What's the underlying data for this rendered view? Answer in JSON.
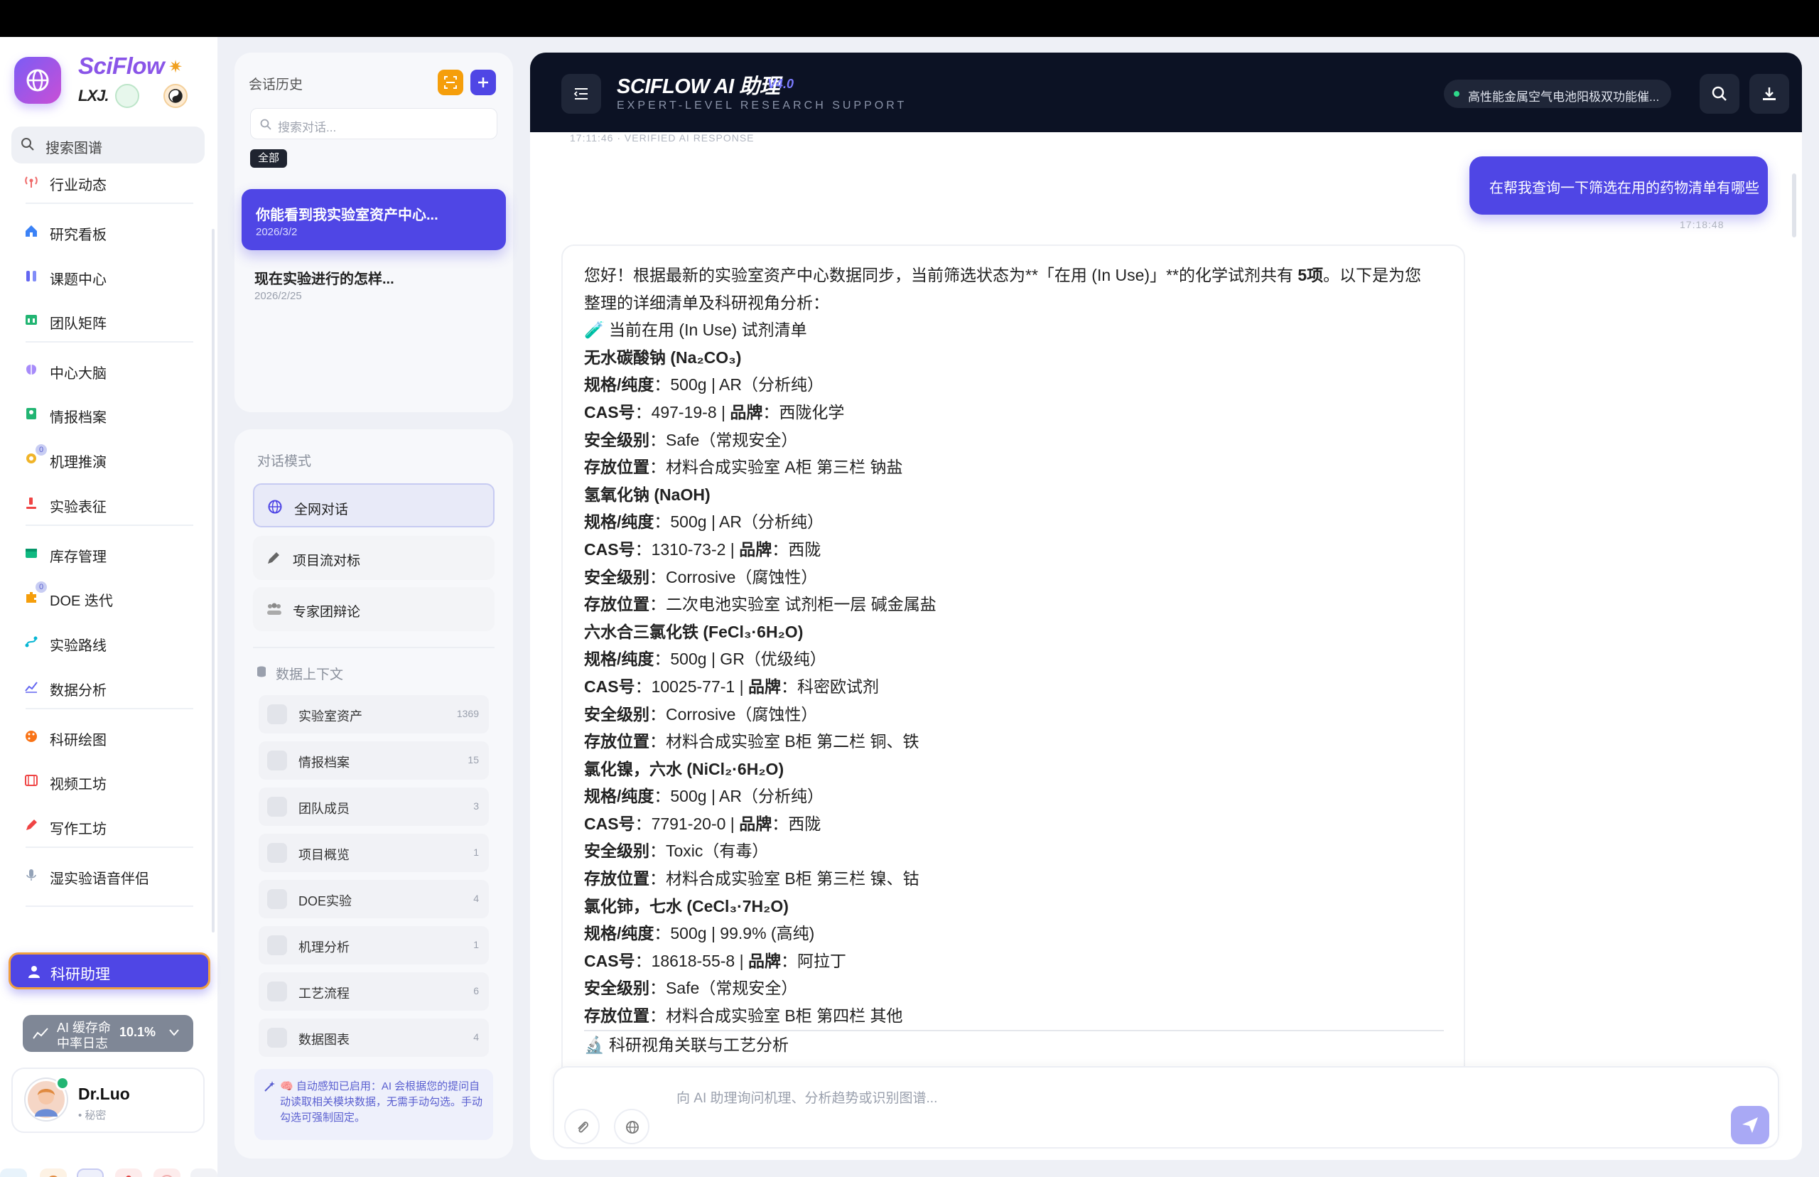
{
  "brand": {
    "name": "SciFlow",
    "sub": "LXJ."
  },
  "sidebar": {
    "search_label": "搜索图谱",
    "items": [
      {
        "label": "行业动态"
      },
      {
        "label": "研究看板"
      },
      {
        "label": "课题中心"
      },
      {
        "label": "团队矩阵"
      },
      {
        "label": "中心大脑"
      },
      {
        "label": "情报档案"
      },
      {
        "label": "机理推演"
      },
      {
        "label": "实验表征"
      },
      {
        "label": "库存管理"
      },
      {
        "label": "DOE 迭代"
      },
      {
        "label": "实验路线"
      },
      {
        "label": "数据分析"
      },
      {
        "label": "科研绘图"
      },
      {
        "label": "视频工坊"
      },
      {
        "label": "写作工坊"
      },
      {
        "label": "湿实验语音伴侣"
      }
    ],
    "active_label": "科研助理",
    "cache": {
      "line1": "AI 缓存命",
      "line2": "中率日志",
      "percent": "10.1%"
    },
    "user": {
      "name": "Dr.Luo",
      "role": "• 秘密"
    }
  },
  "history": {
    "title": "会话历史",
    "search_placeholder": "搜索对话...",
    "filter_all": "全部",
    "conversations": [
      {
        "title": "你能看到我实验室资产中心...",
        "date": "2026/3/2"
      },
      {
        "title": "现在实验进行的怎样...",
        "date": "2026/2/25"
      }
    ]
  },
  "modes": {
    "title": "对话模式",
    "items": [
      {
        "label": "全网对话"
      },
      {
        "label": "项目流对标"
      },
      {
        "label": "专家团辩论"
      }
    ]
  },
  "context": {
    "title": "数据上下文",
    "items": [
      {
        "label": "实验室资产",
        "count": "1369"
      },
      {
        "label": "情报档案",
        "count": "15"
      },
      {
        "label": "团队成员",
        "count": "3"
      },
      {
        "label": "项目概览",
        "count": "1"
      },
      {
        "label": "DOE实验",
        "count": "4"
      },
      {
        "label": "机理分析",
        "count": "1"
      },
      {
        "label": "工艺流程",
        "count": "6"
      },
      {
        "label": "数据图表",
        "count": "4"
      }
    ],
    "note": "🧠 自动感知已启用：AI 会根据您的提问自动读取相关模块数据，无需手动勾选。手动勾选可强制固定。"
  },
  "header": {
    "title": "SCIFLOW AI 助理",
    "version": "V4.0",
    "subtitle": "EXPERT-LEVEL RESEARCH SUPPORT",
    "topic": "高性能金属空气电池阳极双功能催..."
  },
  "chat": {
    "top_timestamp": "17:11:46 · VERIFIED AI RESPONSE",
    "user_message": "在帮我查询一下筛选在用的药物清单有哪些",
    "user_time": "17:18:48",
    "ai": {
      "intro": "您好！根据最新的实验室资产中心数据同步，当前筛选状态为**「在用 (In Use)」**的化学试剂共有 ",
      "intro_bold": "5项",
      "intro_tail": "。以下是为您整理的详细清单及科研视角分析：",
      "list_heading": "🧪 当前在用 (In Use) 试剂清单",
      "labels": {
        "spec": "规格/纯度",
        "cas": "CAS号",
        "brand": "品牌",
        "safety": "安全级别",
        "location": "存放位置"
      },
      "reagents": [
        {
          "name": "无水碳酸钠 (Na₂CO₃)",
          "spec": "500g | AR（分析纯）",
          "cas": "497-19-8",
          "brand": "西陇化学",
          "safety": "Safe（常规安全）",
          "location": "材料合成实验室 A柜 第三栏 钠盐"
        },
        {
          "name": "氢氧化钠 (NaOH)",
          "spec": "500g | AR（分析纯）",
          "cas": "1310-73-2",
          "brand": "西陇",
          "safety": "Corrosive（腐蚀性）",
          "location": "二次电池实验室 试剂柜一层 碱金属盐"
        },
        {
          "name": "六水合三氯化铁 (FeCl₃·6H₂O)",
          "spec": "500g | GR（优级纯）",
          "cas": "10025-77-1",
          "brand": "科密欧试剂",
          "safety": "Corrosive（腐蚀性）",
          "location": "材料合成实验室 B柜 第二栏 铜、铁"
        },
        {
          "name": "氯化镍，六水 (NiCl₂·6H₂O)",
          "spec": "500g | AR（分析纯）",
          "cas": "7791-20-0",
          "brand": "西陇",
          "safety": "Toxic（有毒）",
          "location": "材料合成实验室 B柜 第三栏 镍、钴"
        },
        {
          "name": "氯化铈，七水 (CeCl₃·7H₂O)",
          "spec": "500g | 99.9% (高纯)",
          "cas": "18618-55-8",
          "brand": "阿拉丁",
          "safety": "Safe（常规安全）",
          "location": "材料合成实验室 B柜 第四栏 其他"
        }
      ],
      "analysis_heading": "🔬 科研视角关联与工艺分析"
    }
  },
  "composer": {
    "placeholder": "向 AI 助理询问机理、分析趋势或识别图谱..."
  },
  "colors": {
    "accent": "#4f46e5",
    "header_bg": "#0c1224",
    "brand": "#8a55e8"
  }
}
